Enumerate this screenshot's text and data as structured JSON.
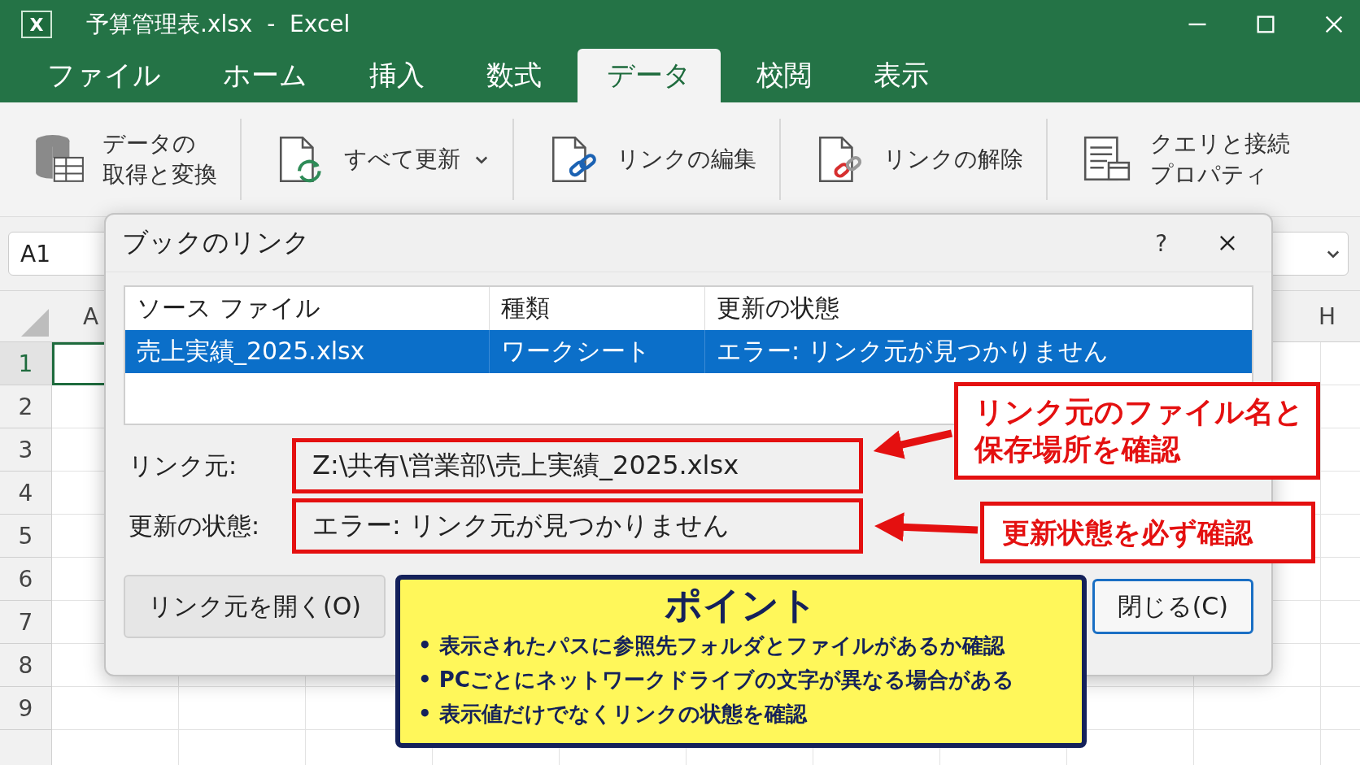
{
  "window": {
    "icon_letter": "X",
    "title": "予算管理表.xlsx  -  Excel"
  },
  "tabs": [
    {
      "label": "ファイル",
      "selected": false
    },
    {
      "label": "ホーム",
      "selected": false
    },
    {
      "label": "挿入",
      "selected": false
    },
    {
      "label": "数式",
      "selected": false
    },
    {
      "label": "データ",
      "selected": true
    },
    {
      "label": "校閲",
      "selected": false
    },
    {
      "label": "表示",
      "selected": false
    }
  ],
  "ribbon": [
    {
      "kind": "database",
      "lines": [
        "データの",
        "取得と変換"
      ],
      "dropdown": false
    },
    {
      "kind": "refresh",
      "lines": [
        "すべて更新"
      ],
      "dropdown": true
    },
    {
      "kind": "edit-links",
      "lines": [
        "リンクの編集"
      ],
      "dropdown": false
    },
    {
      "kind": "break-links",
      "lines": [
        "リンクの解除"
      ],
      "dropdown": false
    },
    {
      "kind": "properties",
      "lines": [
        "クエリと接続",
        "プロパティ"
      ],
      "dropdown": false
    }
  ],
  "name_box": "A1",
  "column_headers": [
    "A",
    "H"
  ],
  "row_numbers": [
    "1",
    "2",
    "3",
    "4",
    "5",
    "6",
    "7",
    "8",
    "9"
  ],
  "dialog": {
    "title": "ブックのリンク",
    "help": "?",
    "columns": [
      "ソース ファイル",
      "種類",
      "更新の状態"
    ],
    "rows": [
      {
        "cells": [
          "売上実績_2025.xlsx",
          "ワークシート",
          "エラー: リンク元が見つかりません"
        ],
        "selected": true
      }
    ],
    "fields": [
      {
        "label": "リンク元:",
        "value": "Z:\\共有\\営業部\\売上実績_2025.xlsx",
        "highlighted": true
      },
      {
        "label": "更新の状態:",
        "value": "エラー: リンク元が見つかりません",
        "highlighted": true
      }
    ],
    "buttons": [
      {
        "label": "リンク元を開く(O)",
        "default": false
      },
      {
        "label": "閉じる(C)",
        "default": true
      }
    ]
  },
  "callouts": [
    {
      "lines": [
        "リンク元のファイル名と",
        "保存場所を確認"
      ]
    },
    {
      "lines": [
        "更新状態を必ず確認"
      ]
    }
  ],
  "point": {
    "title": "ポイント",
    "bullets": [
      "• 表示されたパスに参照先フォルダとファイルがあるか確認",
      "• PCごとにネットワークドライブの文字が異なる場合がある",
      "• 表示値だけでなくリンクの状態を確認"
    ]
  }
}
